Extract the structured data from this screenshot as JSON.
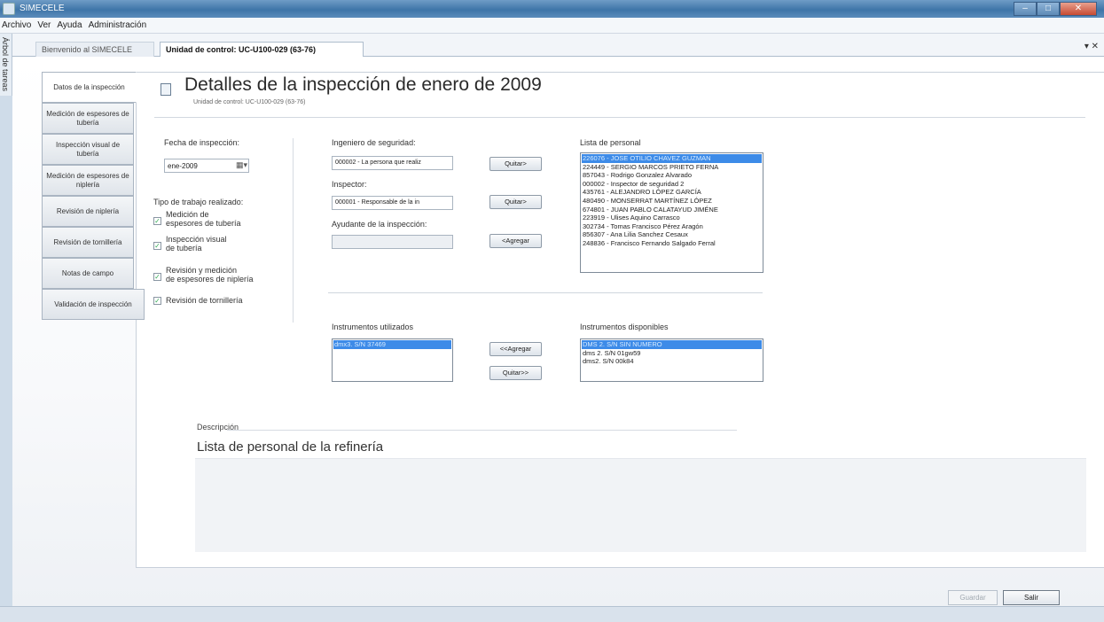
{
  "window": {
    "title": "SIMECELE",
    "buttons": {
      "minimize": "–",
      "maximize": "□",
      "close": "✕"
    }
  },
  "menu": [
    "Archivo",
    "Ver",
    "Ayuda",
    "Administración"
  ],
  "sidebar_tab": "Árbol de tareas",
  "tabs": [
    {
      "label": "Bienvenido al SIMECELE",
      "active": false
    },
    {
      "label": "Unidad de control: UC-U100-029 (63-76)",
      "active": true
    }
  ],
  "close_doc": "▾ ✕",
  "nav": [
    {
      "label": "Datos de la inspección",
      "active": true
    },
    {
      "label": "Medición de espesores de tubería",
      "active": false
    },
    {
      "label": "Inspección visual de tubería",
      "active": false
    },
    {
      "label": "Medición de espesores de niplería",
      "active": false
    },
    {
      "label": "Revisión de niplería",
      "active": false
    },
    {
      "label": "Revisión de tornillería",
      "active": false
    },
    {
      "label": "Notas de campo",
      "active": false
    },
    {
      "label": "Validación de inspección",
      "active": false
    }
  ],
  "header": {
    "title": "Detalles de la inspección de enero de 2009",
    "subtitle": "Unidad de control: UC-U100-029 (63-76)"
  },
  "fecha": {
    "label": "Fecha de inspección:",
    "value": "ene-2009",
    "button": "▦▾"
  },
  "tipo_trabajo": {
    "label": "Tipo de trabajo realizado:",
    "items": [
      {
        "line1": "Medición de",
        "line2": "espesores de tubería",
        "checked": true
      },
      {
        "line1": "Inspección visual",
        "line2": "de tubería",
        "checked": true
      },
      {
        "line1": "Revisión y medición",
        "line2": "de espesores de niplería",
        "checked": true
      },
      {
        "line1": "Revisión de tornillería",
        "line2": "",
        "checked": true
      }
    ],
    "check_glyph": "✓"
  },
  "ingeniero": {
    "label": "Ingeniero de seguridad:",
    "value": "000002 - La persona que realiz",
    "button": "Quitar>"
  },
  "inspector": {
    "label": "Inspector:",
    "value": "000001 - Responsable de la in",
    "button": "Quitar>"
  },
  "ayudante": {
    "label": "Ayudante de la inspección:",
    "value": "",
    "button": "<Agregar"
  },
  "lista_personal": {
    "label": "Lista de personal",
    "items": [
      "226076 - JOSE OTILIO CHAVEZ GUZMAN",
      "224449 - SERGIO MARCOS PRIETO FERNA",
      "857043 - Rodrigo Gonzalez Alvarado",
      "000002 - Inspector de seguridad 2",
      "435761 - ALEJANDRO LÓPEZ GARCÍA",
      "480490 - MONSERRAT MARTÍNEZ LÓPEZ",
      "674801 - JUAN PABLO CALATAYUD JIMÉNE",
      "223919 - Ulises Aquino Carrasco",
      "302734 - Tomas Francisco Pérez Aragón",
      "856307 - Ana Lilia Sanchez Cesaux",
      "248836 - Francisco Fernando Salgado Ferral"
    ],
    "selected_index": 0
  },
  "instrumentos_utilizados": {
    "label": "Instrumentos utilizados",
    "items": [
      "dmx3. S/N 37469"
    ],
    "selected_index": 0
  },
  "instrumentos_buttons": {
    "agregar": "<<Agregar",
    "quitar": "Quitar>>"
  },
  "instrumentos_disponibles": {
    "label": "Instrumentos disponibles",
    "items": [
      "DMS 2. S/N SIN NUMERO",
      "dms 2. S/N 01gw59",
      "dms2. S/N 00k84"
    ],
    "selected_index": 0
  },
  "descripcion": {
    "label": "Descripción",
    "text": "Lista de personal de la refinería"
  },
  "footer": {
    "guardar": "Guardar",
    "salir": "Salir"
  }
}
